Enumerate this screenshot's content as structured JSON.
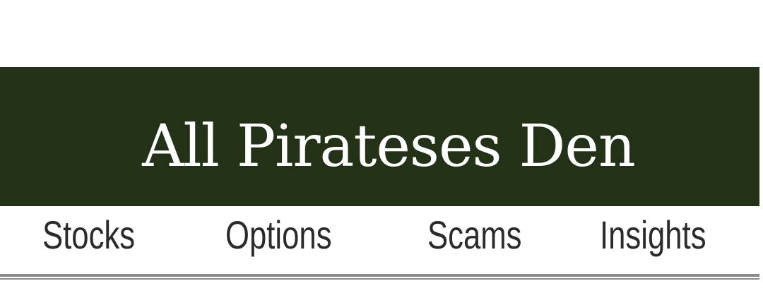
{
  "header": {
    "site_title": "All Pirateses Den",
    "banner_color": "#233216"
  },
  "nav": {
    "items": [
      {
        "label": "Stocks"
      },
      {
        "label": "Options"
      },
      {
        "label": "Scams"
      },
      {
        "label": "Insights"
      }
    ]
  }
}
